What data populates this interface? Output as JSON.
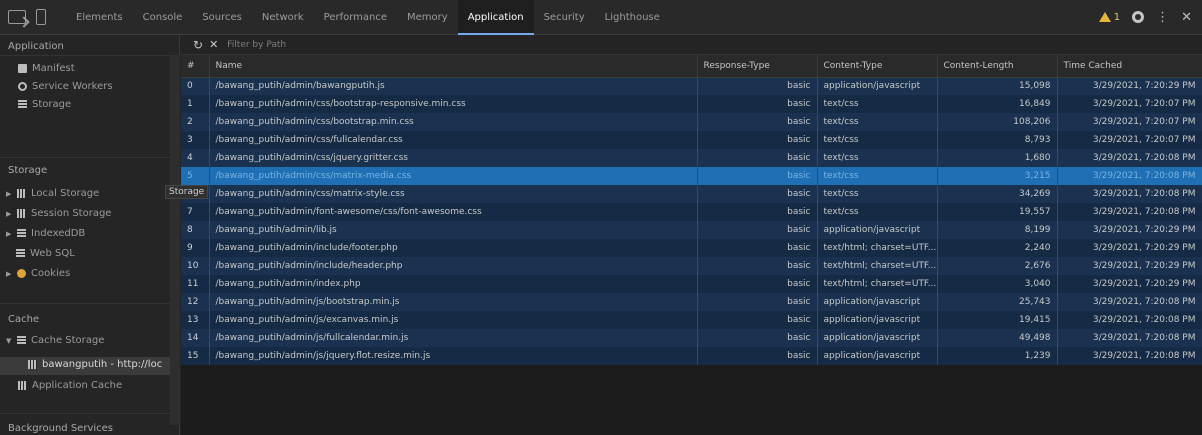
{
  "toolbar": {
    "tabs": [
      {
        "label": "Elements",
        "active": false
      },
      {
        "label": "Console",
        "active": false
      },
      {
        "label": "Sources",
        "active": false
      },
      {
        "label": "Network",
        "active": false
      },
      {
        "label": "Performance",
        "active": false
      },
      {
        "label": "Memory",
        "active": false
      },
      {
        "label": "Application",
        "active": true
      },
      {
        "label": "Security",
        "active": false
      },
      {
        "label": "Lighthouse",
        "active": false
      }
    ],
    "warning_count": "1"
  },
  "sidebar": {
    "application_header": "Application",
    "application_items": [
      {
        "label": "Manifest",
        "icon": "doc-icon"
      },
      {
        "label": "Service Workers",
        "icon": "gear-icon"
      },
      {
        "label": "Storage",
        "icon": "database-icon"
      }
    ],
    "storage_header": "Storage",
    "storage_items": [
      {
        "label": "Local Storage",
        "icon": "grid-icon",
        "expandable": true
      },
      {
        "label": "Session Storage",
        "icon": "grid-icon",
        "expandable": true
      },
      {
        "label": "IndexedDB",
        "icon": "database-icon",
        "expandable": true
      },
      {
        "label": "Web SQL",
        "icon": "database-icon",
        "expandable": false
      },
      {
        "label": "Cookies",
        "icon": "cookie-icon",
        "expandable": true
      }
    ],
    "cache_header": "Cache",
    "cache_items": [
      {
        "label": "Cache Storage",
        "icon": "database-icon",
        "expandable": true,
        "expanded": true
      },
      {
        "label": "bawangputih - http://loc",
        "icon": "grid-icon",
        "selected": true
      },
      {
        "label": "Application Cache",
        "icon": "grid-icon"
      }
    ],
    "background_header": "Background Services",
    "tooltip": "Storage"
  },
  "filter": {
    "placeholder": "Filter by Path"
  },
  "table": {
    "columns": [
      "#",
      "Name",
      "Response-Type",
      "Content-Type",
      "Content-Length",
      "Time Cached"
    ],
    "rows": [
      {
        "n": "0",
        "name": "/bawang_putih/admin/bawangputih.js",
        "rtype": "basic",
        "ctype": "application/javascript",
        "clen": "15,098",
        "time": "3/29/2021, 7:20:29 PM"
      },
      {
        "n": "1",
        "name": "/bawang_putih/admin/css/bootstrap-responsive.min.css",
        "rtype": "basic",
        "ctype": "text/css",
        "clen": "16,849",
        "time": "3/29/2021, 7:20:07 PM"
      },
      {
        "n": "2",
        "name": "/bawang_putih/admin/css/bootstrap.min.css",
        "rtype": "basic",
        "ctype": "text/css",
        "clen": "108,206",
        "time": "3/29/2021, 7:20:07 PM"
      },
      {
        "n": "3",
        "name": "/bawang_putih/admin/css/fullcalendar.css",
        "rtype": "basic",
        "ctype": "text/css",
        "clen": "8,793",
        "time": "3/29/2021, 7:20:07 PM"
      },
      {
        "n": "4",
        "name": "/bawang_putih/admin/css/jquery.gritter.css",
        "rtype": "basic",
        "ctype": "text/css",
        "clen": "1,680",
        "time": "3/29/2021, 7:20:08 PM"
      },
      {
        "n": "5",
        "name": "/bawang_putih/admin/css/matrix-media.css",
        "rtype": "basic",
        "ctype": "text/css",
        "clen": "3,215",
        "time": "3/29/2021, 7:20:08 PM"
      },
      {
        "n": "6",
        "name": "/bawang_putih/admin/css/matrix-style.css",
        "rtype": "basic",
        "ctype": "text/css",
        "clen": "34,269",
        "time": "3/29/2021, 7:20:08 PM"
      },
      {
        "n": "7",
        "name": "/bawang_putih/admin/font-awesome/css/font-awesome.css",
        "rtype": "basic",
        "ctype": "text/css",
        "clen": "19,557",
        "time": "3/29/2021, 7:20:08 PM"
      },
      {
        "n": "8",
        "name": "/bawang_putih/admin/lib.js",
        "rtype": "basic",
        "ctype": "application/javascript",
        "clen": "8,199",
        "time": "3/29/2021, 7:20:29 PM"
      },
      {
        "n": "9",
        "name": "/bawang_putih/admin/include/footer.php",
        "rtype": "basic",
        "ctype": "text/html; charset=UTF...",
        "clen": "2,240",
        "time": "3/29/2021, 7:20:29 PM"
      },
      {
        "n": "10",
        "name": "/bawang_putih/admin/include/header.php",
        "rtype": "basic",
        "ctype": "text/html; charset=UTF...",
        "clen": "2,676",
        "time": "3/29/2021, 7:20:29 PM"
      },
      {
        "n": "11",
        "name": "/bawang_putih/admin/index.php",
        "rtype": "basic",
        "ctype": "text/html; charset=UTF...",
        "clen": "3,040",
        "time": "3/29/2021, 7:20:29 PM"
      },
      {
        "n": "12",
        "name": "/bawang_putih/admin/js/bootstrap.min.js",
        "rtype": "basic",
        "ctype": "application/javascript",
        "clen": "25,743",
        "time": "3/29/2021, 7:20:08 PM"
      },
      {
        "n": "13",
        "name": "/bawang_putih/admin/js/excanvas.min.js",
        "rtype": "basic",
        "ctype": "application/javascript",
        "clen": "19,415",
        "time": "3/29/2021, 7:20:08 PM"
      },
      {
        "n": "14",
        "name": "/bawang_putih/admin/js/fullcalendar.min.js",
        "rtype": "basic",
        "ctype": "application/javascript",
        "clen": "49,498",
        "time": "3/29/2021, 7:20:08 PM"
      },
      {
        "n": "15",
        "name": "/bawang_putih/admin/js/jquery.flot.resize.min.js",
        "rtype": "basic",
        "ctype": "application/javascript",
        "clen": "1,239",
        "time": "3/29/2021, 7:20:08 PM"
      }
    ]
  }
}
